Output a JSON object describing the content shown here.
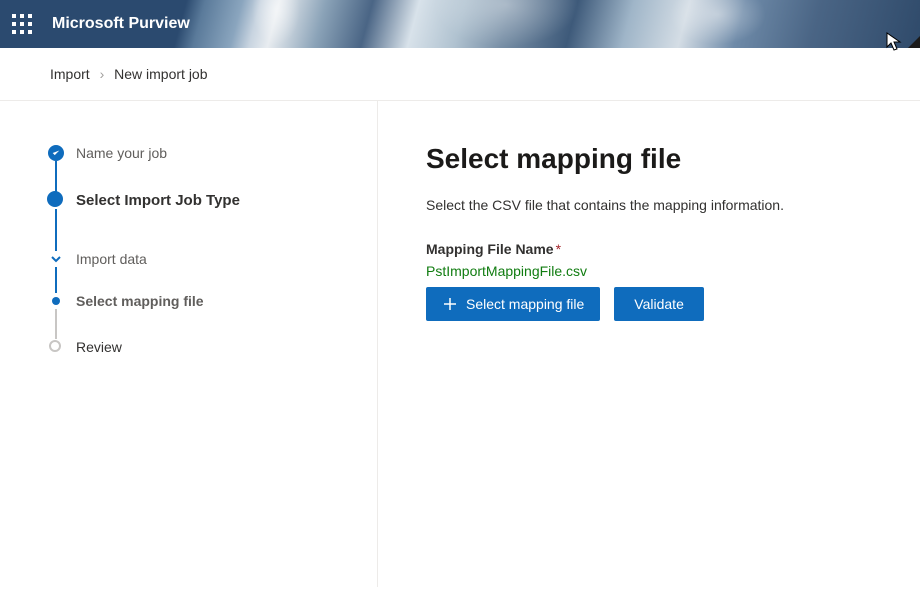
{
  "app_title": "Microsoft Purview",
  "breadcrumb": {
    "root": "Import",
    "current": "New import job"
  },
  "steps": {
    "name_job": "Name your job",
    "select_type": "Select Import Job Type",
    "import_data": "Import data",
    "select_mapping": "Select mapping file",
    "review": "Review"
  },
  "main": {
    "heading": "Select mapping file",
    "description": "Select the CSV file that contains the mapping information.",
    "field_label": "Mapping File Name",
    "required_mark": "*",
    "selected_file": "PstImportMappingFile.csv",
    "select_button": "Select mapping file",
    "validate_button": "Validate"
  }
}
